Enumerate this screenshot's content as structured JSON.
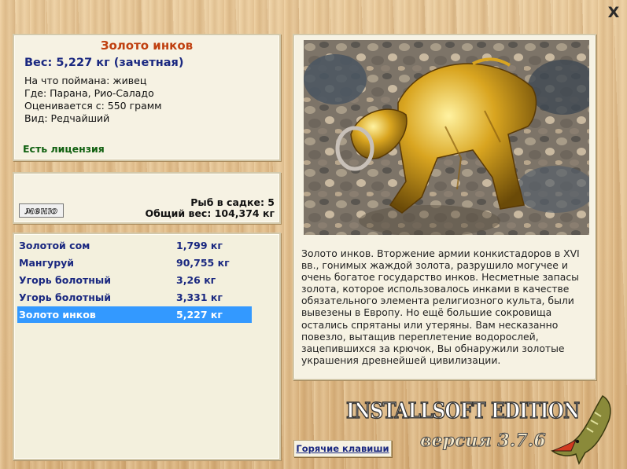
{
  "window": {
    "close_label": "X"
  },
  "fish_info": {
    "title": "Золото инков",
    "weight": "Вес: 5,227 кг (зачетная)",
    "bait": "На что поймана: живец",
    "location": "Где: Парана, Рио-Саладо",
    "rated_from": "Оценивается с: 550 грамм",
    "kind": "Вид: Редчайший",
    "license": "Есть лицензия"
  },
  "cage": {
    "menu_label": "меню",
    "fish_count": "Рыб в садке: 5",
    "total_weight": "Общий вес: 104,374 кг"
  },
  "fish_list": [
    {
      "name": "Золотой сом",
      "weight": "1,799 кг",
      "selected": false
    },
    {
      "name": "Мангуруй",
      "weight": "90,755 кг",
      "selected": false
    },
    {
      "name": "Угорь болотный",
      "weight": "3,26 кг",
      "selected": false
    },
    {
      "name": "Угорь болотный",
      "weight": "3,331 кг",
      "selected": false
    },
    {
      "name": "Золото инков",
      "weight": "5,227 кг",
      "selected": true
    }
  ],
  "description": "Золото инков. Вторжение армии конкистадоров в XVI вв., гонимых жаждой золота, разрушило могучее и очень богатое государство инков. Несметные запасы золота, которое использовалось инками в качестве обязательного элемента религиозного культа, были вывезены в Европу. Но ещё большие сокровища остались спрятаны или утеряны. Вам несказанно повезло, вытащив переплетение водорослей, зацепившихся за крючок, Вы обнаружили золотые украшения древнейшей цивилизации.",
  "footer": {
    "brand": "INSTALLSOFT EDITION",
    "version": "версия 3.7.6",
    "hotkeys_label": "Горячие клавиши"
  },
  "colors": {
    "title": "#c04010",
    "fish_names": "#1a2880",
    "license": "#106010",
    "selection": "#3399ff",
    "panel_bg": "#f6f2e3"
  }
}
